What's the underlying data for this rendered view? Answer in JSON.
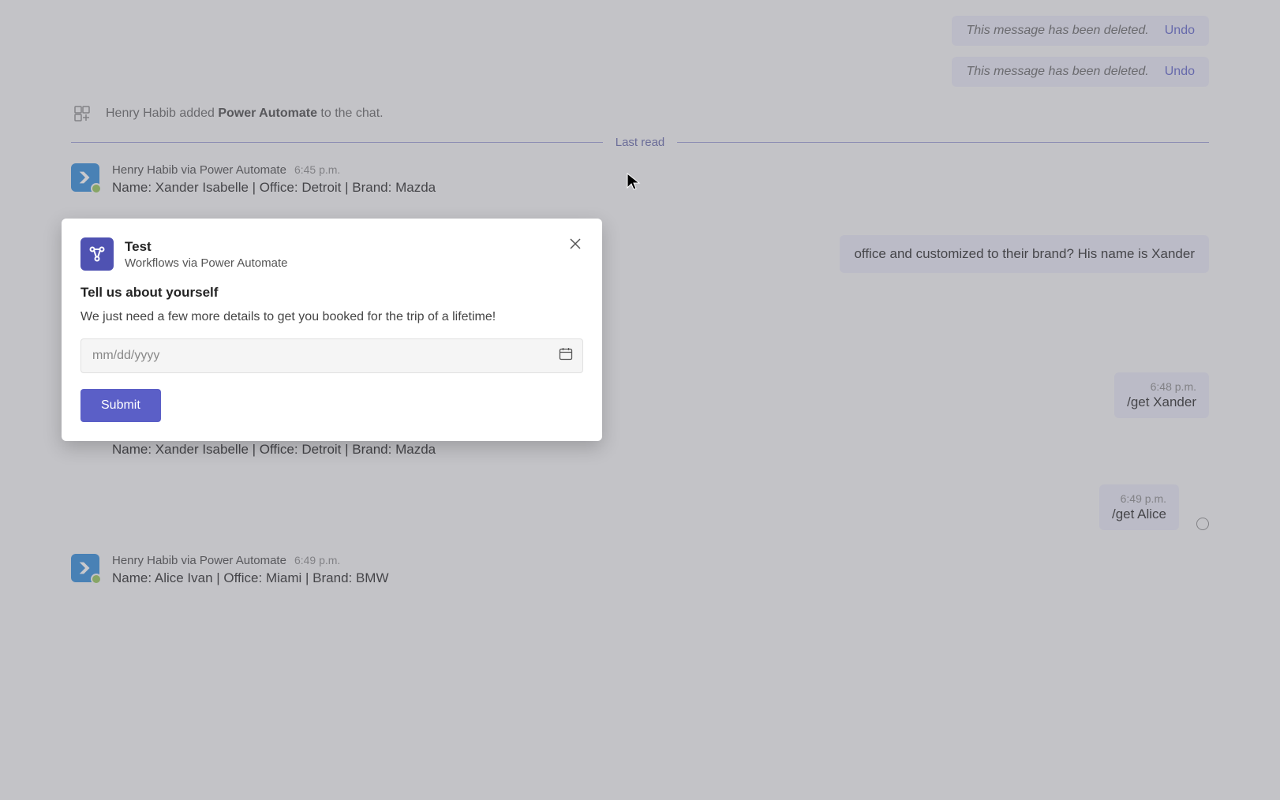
{
  "deleted_messages": [
    {
      "text": "This message has been deleted.",
      "undo": "Undo"
    },
    {
      "text": "This message has been deleted.",
      "undo": "Undo"
    }
  ],
  "system_message": {
    "prefix": "Henry Habib added ",
    "app": "Power Automate",
    "suffix": " to the chat."
  },
  "last_read": "Last read",
  "messages": [
    {
      "author": "Henry Habib via Power Automate",
      "time": "6:45 p.m.",
      "body": "Name: Xander Isabelle | Office: Detroit | Brand: Mazda"
    }
  ],
  "partial_right_message": "office and customized to their brand? His name is Xander",
  "right_messages": [
    {
      "time": "6:48 p.m.",
      "body": "/get Xander"
    },
    {
      "time": "6:49 p.m.",
      "body": "/get Alice"
    }
  ],
  "message_after_modal": {
    "body": "Name: Xander Isabelle | Office: Detroit | Brand: Mazda"
  },
  "bottom_message": {
    "author": "Henry Habib via Power Automate",
    "time": "6:49 p.m.",
    "body": "Name: Alice Ivan | Office: Miami | Brand: BMW"
  },
  "modal": {
    "title": "Test",
    "subtitle": "Workflows via Power Automate",
    "heading": "Tell us about yourself",
    "description": "We just need a few more details to get you booked for the trip of a lifetime!",
    "date_placeholder": "mm/dd/yyyy",
    "submit_label": "Submit"
  }
}
